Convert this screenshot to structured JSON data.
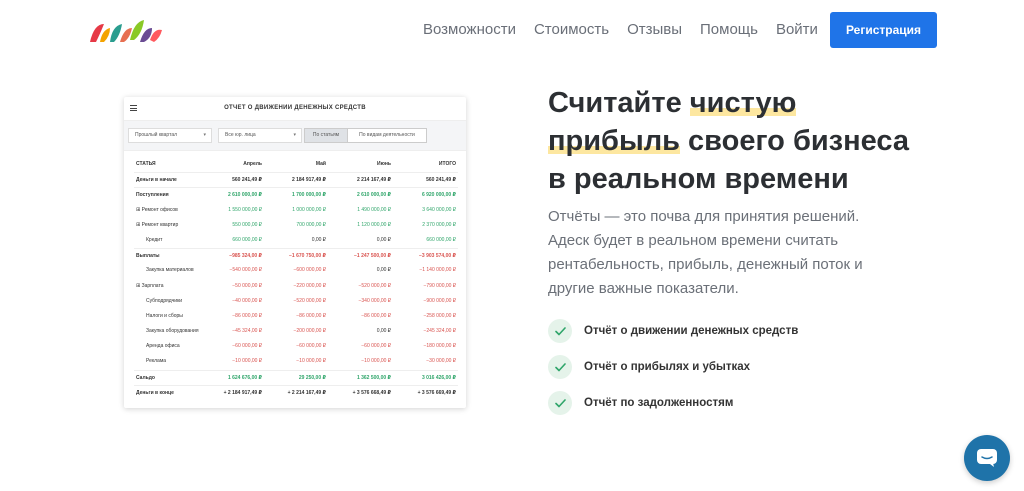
{
  "header": {
    "nav": [
      "Возможности",
      "Стоимость",
      "Отзывы",
      "Помощь",
      "Войти"
    ],
    "register_label": "Регистрация"
  },
  "report": {
    "title": "ОТЧЕТ О ДВИЖЕНИИ ДЕНЕЖНЫХ СРЕДСТВ",
    "filters": {
      "period": "Прошлый квартал",
      "entity": "Все юр. лица",
      "mode_articles": "По статьям",
      "mode_activity": "По видам деятельности"
    },
    "columns": [
      "СТАТЬЯ",
      "Апрель",
      "Май",
      "Июнь",
      "ИТОГО"
    ],
    "rows": [
      {
        "label": "Деньги в начале",
        "v": [
          "560 241,49 ₽",
          "2 184 917,49 ₽",
          "2 214 167,49 ₽",
          "560 241,49 ₽"
        ]
      },
      {
        "label": "Поступления",
        "v": [
          "2 610 000,00 ₽",
          "1 700 000,00 ₽",
          "2 610 000,00 ₽",
          "6 920 000,00 ₽"
        ]
      },
      {
        "label": "⊞ Ремонт офисов",
        "v": [
          "1 550 000,00 ₽",
          "1 000 000,00 ₽",
          "1 490 000,00 ₽",
          "3 640 000,00 ₽"
        ]
      },
      {
        "label": "⊞ Ремонт квартир",
        "v": [
          "550 000,00 ₽",
          "700 000,00 ₽",
          "1 120 000,00 ₽",
          "2 370 000,00 ₽"
        ]
      },
      {
        "label": "Кредит",
        "v": [
          "660 000,00 ₽",
          "0,00 ₽",
          "0,00 ₽",
          "660 000,00 ₽"
        ]
      },
      {
        "label": "Выплаты",
        "v": [
          "−985 324,00 ₽",
          "−1 670 750,00 ₽",
          "−1 247 500,00 ₽",
          "−3 903 574,00 ₽"
        ]
      },
      {
        "label": "Закупка материалов",
        "v": [
          "−540 000,00 ₽",
          "−600 000,00 ₽",
          "0,00 ₽",
          "−1 140 000,00 ₽"
        ]
      },
      {
        "label": "⊞ Зарплата",
        "v": [
          "−50 000,00 ₽",
          "−220 000,00 ₽",
          "−520 000,00 ₽",
          "−790 000,00 ₽"
        ]
      },
      {
        "label": "Субподрядчики",
        "v": [
          "−40 000,00 ₽",
          "−520 000,00 ₽",
          "−340 000,00 ₽",
          "−900 000,00 ₽"
        ]
      },
      {
        "label": "Налоги и сборы",
        "v": [
          "−86 000,00 ₽",
          "−86 000,00 ₽",
          "−86 000,00 ₽",
          "−258 000,00 ₽"
        ]
      },
      {
        "label": "Закупка оборудования",
        "v": [
          "−45 324,00 ₽",
          "−200 000,00 ₽",
          "0,00 ₽",
          "−245 324,00 ₽"
        ]
      },
      {
        "label": "Аренда офиса",
        "v": [
          "−60 000,00 ₽",
          "−60 000,00 ₽",
          "−60 000,00 ₽",
          "−180 000,00 ₽"
        ]
      },
      {
        "label": "Реклама",
        "v": [
          "−10 000,00 ₽",
          "−10 000,00 ₽",
          "−10 000,00 ₽",
          "−30 000,00 ₽"
        ]
      },
      {
        "label": "Сальдо",
        "v": [
          "1 624 676,00 ₽",
          "29 250,00 ₽",
          "1 362 500,00 ₽",
          "3 016 426,00 ₽"
        ]
      },
      {
        "label": "Деньги в конце",
        "v": [
          "+ 2 184 917,49 ₽",
          "+ 2 214 167,49 ₽",
          "+ 3 576 668,49 ₽",
          "+ 3 576 669,49 ₽"
        ]
      }
    ]
  },
  "hero": {
    "headline_pre": "Считайте ",
    "headline_highlight": "чистую прибыль",
    "headline_post": " своего бизнеса в реальном времени",
    "lead": "Отчёты — это почва для принятия решений. Адеск будет в реальном времени считать рентабельность, прибыль, денежный поток и другие важные показатели.",
    "features": [
      "Отчёт о движении денежных средств",
      "Отчёт о прибылях и убытках",
      "Отчёт по задолженностям"
    ]
  },
  "colors": {
    "accent": "#1f74e8",
    "positive": "#2fa56a",
    "negative": "#d9534f",
    "highlight": "#fde7a0",
    "chat": "#1f73a9"
  },
  "icons": [
    "logo",
    "menu-icon",
    "chevron-down-icon",
    "check-icon",
    "chat-icon"
  ]
}
